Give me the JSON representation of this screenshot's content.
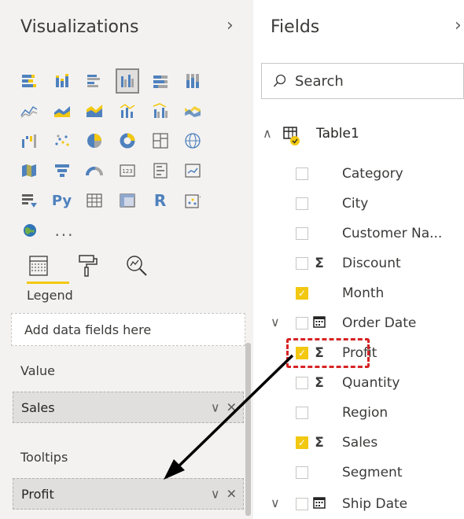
{
  "visualizations": {
    "title": "Visualizations",
    "collapse_icon": "chevron-right-icon",
    "tabs": [
      "fields-well-icon",
      "format-paint-roller-icon",
      "analytics-magnifier-icon"
    ],
    "legend_label": "Legend",
    "legend_placeholder": "Add data fields here",
    "value_label": "Value",
    "value_field": "Sales",
    "tooltips_label": "Tooltips",
    "tooltips_field": "Profit",
    "more_visuals": "..."
  },
  "fields": {
    "title": "Fields",
    "collapse_icon": "chevron-right-icon",
    "search_placeholder": "Search",
    "table_name": "Table1",
    "items": [
      {
        "name": "Category",
        "checked": false,
        "sigma": false
      },
      {
        "name": "City",
        "checked": false,
        "sigma": false
      },
      {
        "name": "Customer Na...",
        "checked": false,
        "sigma": false
      },
      {
        "name": "Discount",
        "checked": false,
        "sigma": true
      },
      {
        "name": "Month",
        "checked": true,
        "sigma": false
      },
      {
        "name": "Order Date",
        "checked": false,
        "sigma": false,
        "hierarchy": true
      },
      {
        "name": "Profit",
        "checked": true,
        "sigma": true
      },
      {
        "name": "Quantity",
        "checked": false,
        "sigma": true
      },
      {
        "name": "Region",
        "checked": false,
        "sigma": false
      },
      {
        "name": "Sales",
        "checked": true,
        "sigma": true
      },
      {
        "name": "Segment",
        "checked": false,
        "sigma": false
      },
      {
        "name": "Ship Date",
        "checked": false,
        "sigma": false,
        "hierarchy": true
      }
    ]
  },
  "colors": {
    "accent_yellow": "#f2c811",
    "highlight_red": "#d62323",
    "pane_bg": "#f3f2f1"
  }
}
